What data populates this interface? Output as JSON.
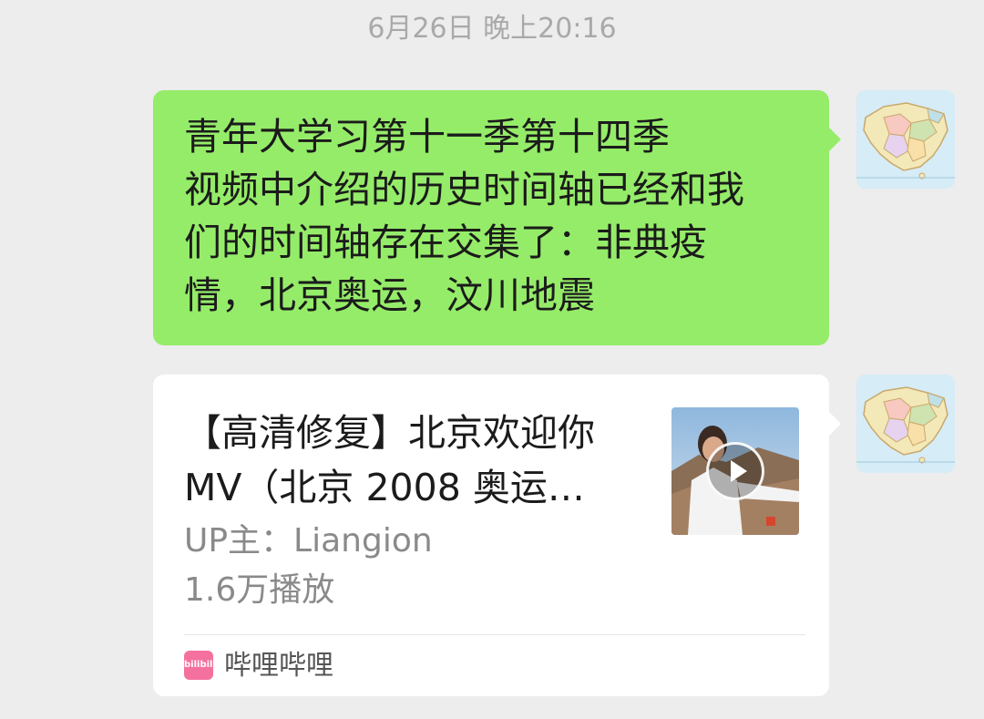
{
  "chat": {
    "timestamp": "6月26日 晚上20:16",
    "messages": [
      {
        "type": "text",
        "text": "青年大学习第十一季第十四季\n视频中介绍的历史时间轴已经和我\n们的时间轴存在交集了：非典疫\n情，北京奥运，汶川地震"
      },
      {
        "type": "video_card",
        "title": "【高清修复】北京欢迎你\nMV（北京 2008 奥运…",
        "uploader": "UP主：Liangion",
        "views": "1.6万播放",
        "source_icon_text": "bilibili",
        "source": "哔哩哔哩"
      }
    ]
  },
  "colors": {
    "background": "#ededed",
    "sent_bubble": "#95ec69",
    "card_background": "#ffffff",
    "bilibili_pink": "#f4709e"
  },
  "icons": {
    "avatar": "china-map-avatar",
    "play": "play-icon",
    "source": "bilibili-logo-icon"
  }
}
